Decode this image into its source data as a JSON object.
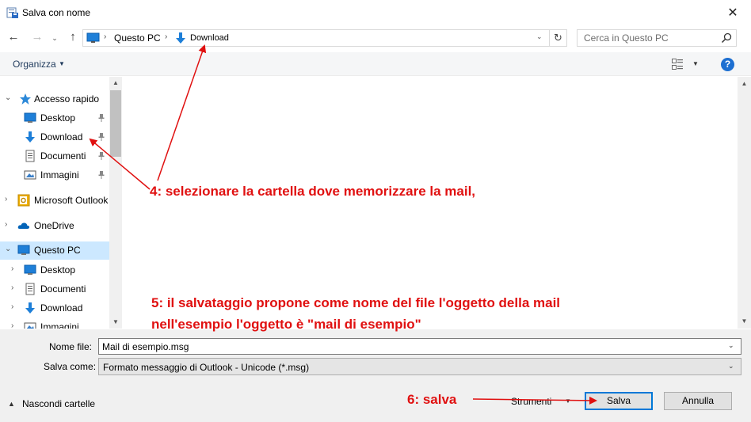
{
  "window": {
    "title": "Salva con nome",
    "close_glyph": "✕",
    "icon": "save-dialog-icon"
  },
  "address": {
    "back_glyph": "←",
    "forward_glyph": "→",
    "recent_glyph": "⌄",
    "up_glyph": "↑",
    "separator": "›",
    "crumbs": [
      "Questo PC",
      "Download"
    ],
    "dropdown_glyph": "⌄",
    "refresh_glyph": "↻"
  },
  "search": {
    "placeholder": "Cerca in Questo PC"
  },
  "toolbar": {
    "organize_label": "Organizza",
    "arrow": "▼",
    "view_arrow": "▼",
    "help_label": "?"
  },
  "nav": {
    "expand_open": "⌄",
    "expand_closed": "›",
    "items": [
      {
        "label": "Accesso rapido",
        "icon": "star-icon",
        "level": 0,
        "expanded": true
      },
      {
        "label": "Desktop",
        "icon": "desktop-icon",
        "level": 1,
        "pinned": true
      },
      {
        "label": "Download",
        "icon": "download-icon",
        "level": 1,
        "pinned": true
      },
      {
        "label": "Documenti",
        "icon": "document-icon",
        "level": 1,
        "pinned": true
      },
      {
        "label": "Immagini",
        "icon": "pictures-icon",
        "level": 1,
        "pinned": true
      },
      {
        "label": "Microsoft Outlook",
        "icon": "outlook-icon",
        "level": 0,
        "expanded": false
      },
      {
        "label": "OneDrive",
        "icon": "onedrive-icon",
        "level": 0,
        "expanded": false
      },
      {
        "label": "Questo PC",
        "icon": "pc-icon",
        "level": 0,
        "expanded": true,
        "selected": true
      },
      {
        "label": "Desktop",
        "icon": "desktop-icon",
        "level": 1,
        "expanded": false
      },
      {
        "label": "Documenti",
        "icon": "document-icon",
        "level": 1,
        "expanded": false
      },
      {
        "label": "Download",
        "icon": "download-icon",
        "level": 1,
        "expanded": false
      },
      {
        "label": "Immagini",
        "icon": "pictures-icon",
        "level": 1,
        "expanded": false
      }
    ]
  },
  "scroll": {
    "up_glyph": "▲",
    "down_glyph": "▼"
  },
  "form": {
    "filename_label": "Nome file:",
    "filename_value": "Mail di esempio.msg",
    "savetype_label": "Salva come:",
    "savetype_value": "Formato messaggio di Outlook - Unicode (*.msg)",
    "dropdown_glyph": "⌄",
    "hide_folders_arrow": "▲",
    "hide_folders_label": "Nascondi cartelle",
    "tools_label": "Strumenti",
    "tools_arrow": "▼",
    "save_label": "Salva",
    "cancel_label": "Annulla"
  },
  "annotations": {
    "step4": "4: selezionare la cartella dove memorizzare la mail,",
    "step5_line1": "5: il salvataggio propone come nome del file l'oggetto della mail",
    "step5_line2": "nell'esempio l'oggetto è \"mail di esempio\"",
    "step6": "6: salva",
    "color": "#e01010"
  },
  "colors": {
    "selection": "#cce8ff",
    "accent": "#0078d7",
    "help": "#1d6fd1"
  }
}
